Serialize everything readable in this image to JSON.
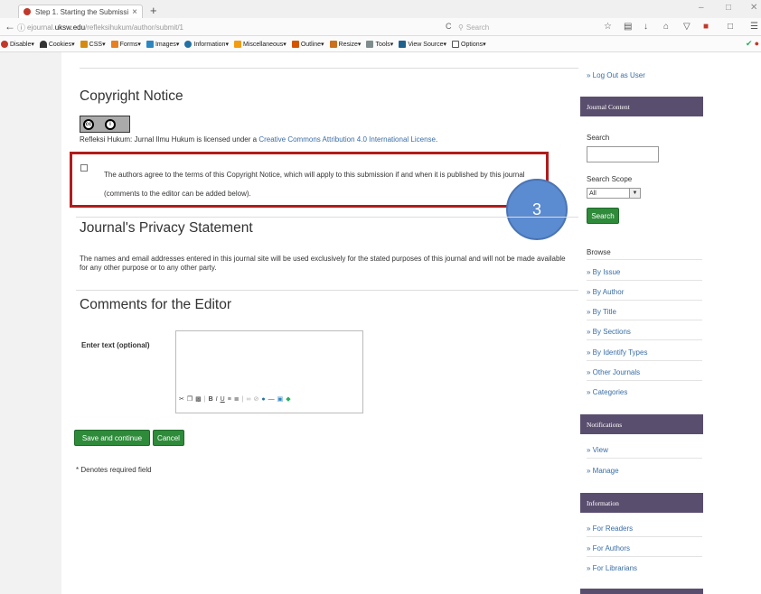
{
  "browser": {
    "tab_title": "Step 1. Starting the Submissi",
    "tab_close": "×",
    "new_tab": "+",
    "url_prefix": "ejournal.",
    "url_domain": "uksw.edu",
    "url_path": "/refleksihukum/author/submit/1",
    "search_placeholder": "Search",
    "window_min": "–",
    "window_max": "□",
    "window_close": "✕"
  },
  "devtoolbar": {
    "items": [
      "Disable▾",
      "Cookies▾",
      "CSS▾",
      "Forms▾",
      "Images▾",
      "Information▾",
      "Miscellaneous▾",
      "Outline▾",
      "Resize▾",
      "Tools▾",
      "View Source▾",
      "Options▾"
    ]
  },
  "main": {
    "copyright_title": "Copyright Notice",
    "license_prefix": "Refleksi Hukum: Jurnal Ilmu Hukum is licensed under a ",
    "license_link": "Creative Commons Attribution 4.0 International License",
    "license_suffix": ".",
    "agree_text": "The authors agree to the terms of this Copyright Notice, which will apply to this submission if and when it is published by this journal (comments to the editor can be added below).",
    "step_number": "3",
    "privacy_title": "Journal's Privacy Statement",
    "privacy_text": "The names and email addresses entered in this journal site will be used exclusively for the stated purposes of this journal and will not be made available for any other purpose or to any other party.",
    "comments_title": "Comments for the Editor",
    "comments_label": "Enter text (optional)",
    "save_label": "Save and continue",
    "cancel_label": "Cancel",
    "required_note": "* Denotes required field"
  },
  "sidebar": {
    "logout": "» Log Out as User",
    "journal_content": "Journal Content",
    "search_label": "Search",
    "search_scope_label": "Search Scope",
    "scope_value": "All",
    "search_button": "Search",
    "browse_label": "Browse",
    "browse_links": [
      "» By Issue",
      "» By Author",
      "» By Title",
      "» By Sections",
      "» By Identify Types",
      "» Other Journals",
      "» Categories"
    ],
    "notifications": "Notifications",
    "notification_links": [
      "» View",
      "» Manage"
    ],
    "information": "Information",
    "information_links": [
      "» For Readers",
      "» For Authors",
      "» For Librarians"
    ]
  },
  "colors": {
    "accent_green": "#2e8b3a",
    "highlight_red": "#b01c1c",
    "sidebar_header": "#5a4e6e",
    "link_blue": "#3a6ea5",
    "step_blue": "#5b8bd0"
  }
}
